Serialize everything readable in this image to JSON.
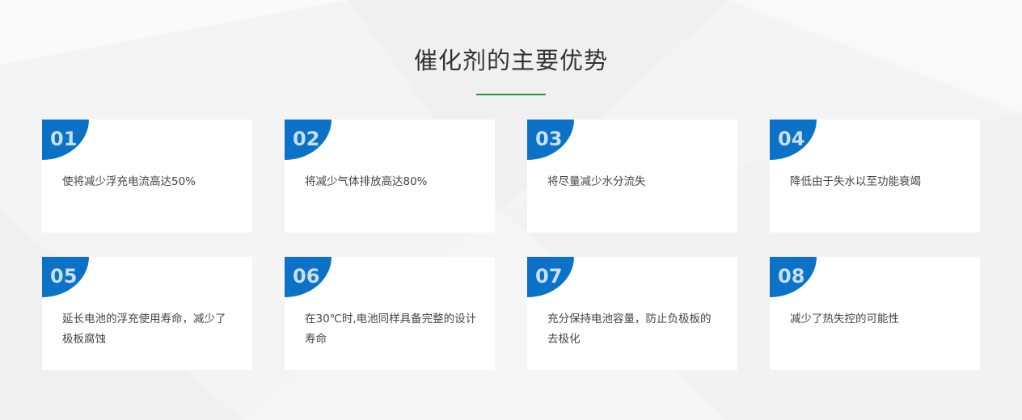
{
  "section": {
    "title": "催化剂的主要优势",
    "accent_color": "#1e9a4a",
    "badge_color": "#0b72c7"
  },
  "cards": [
    {
      "number": "01",
      "text": "使将减少浮充电流高达50%"
    },
    {
      "number": "02",
      "text": "将减少气体排放高达80%"
    },
    {
      "number": "03",
      "text": "将尽量减少水分流失"
    },
    {
      "number": "04",
      "text": "降低由于失水以至功能衰竭"
    },
    {
      "number": "05",
      "text": "延长电池的浮充使用寿命，减少了极板腐蚀"
    },
    {
      "number": "06",
      "text": "在30℃时,电池同样具备完整的设计寿命"
    },
    {
      "number": "07",
      "text": "充分保持电池容量，防止负极板的去极化"
    },
    {
      "number": "08",
      "text": "减少了热失控的可能性"
    }
  ]
}
